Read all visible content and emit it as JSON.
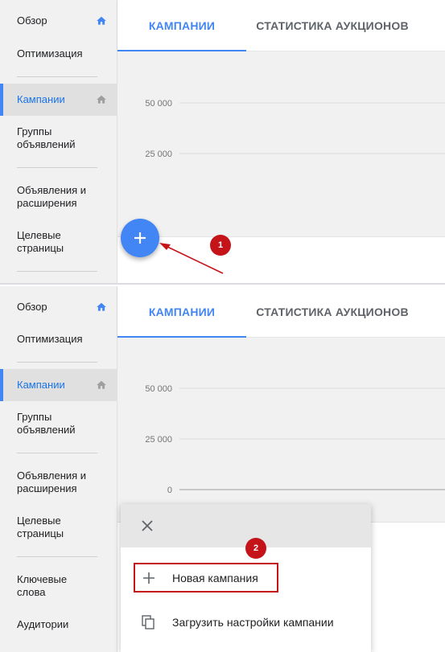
{
  "sidebar": {
    "overview": "Обзор",
    "optimization": "Оптимизация",
    "campaigns": "Кампании",
    "ad_groups_line1": "Группы",
    "ad_groups_line2": "объявлений",
    "ads_line1": "Объявления и",
    "ads_line2": "расширения",
    "landing_line1": "Целевые",
    "landing_line2": "страницы",
    "keywords_line1": "Ключевые",
    "keywords_line2": "слова",
    "audiences": "Аудитории"
  },
  "tabs": {
    "campaigns": "КАМПАНИИ",
    "auction_stats": "СТАТИСТИКА АУКЦИОНОВ"
  },
  "chart_data": {
    "type": "line",
    "ytick_labels": [
      "50 000",
      "25 000",
      "0"
    ],
    "series": []
  },
  "fab": {
    "icon": "plus-icon"
  },
  "step_badges": {
    "step1": "1",
    "step2": "2"
  },
  "menu": {
    "close_icon": "close-icon",
    "new_campaign": "Новая кампания",
    "load_settings": "Загрузить настройки кампании"
  },
  "colors": {
    "accent": "#4285f4",
    "annotation_red": "#c4141a",
    "sidebar_bg": "#f1f1f1"
  }
}
